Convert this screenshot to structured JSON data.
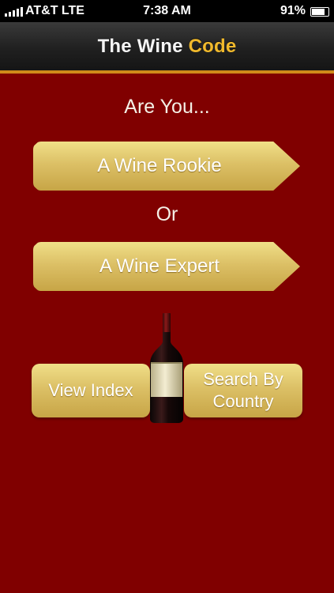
{
  "status_bar": {
    "carrier": "AT&T  LTE",
    "time": "7:38 AM",
    "battery": "91%",
    "battery_level": 0.91
  },
  "nav": {
    "title_part1": "The Wine",
    "title_part2": "Code"
  },
  "main": {
    "prompt": "Are You...",
    "rookie_button": "A Wine Rookie",
    "or_text": "Or",
    "expert_button": "A Wine Expert",
    "view_index_button": "View Index",
    "search_country_line1": "Search By",
    "search_country_line2": "Country"
  },
  "colors": {
    "background": "#800000",
    "accent": "#f0b92c",
    "button_gold": "#dcc066"
  },
  "icons": [
    "signal-bars-icon",
    "battery-icon",
    "wine-bottle-icon"
  ]
}
